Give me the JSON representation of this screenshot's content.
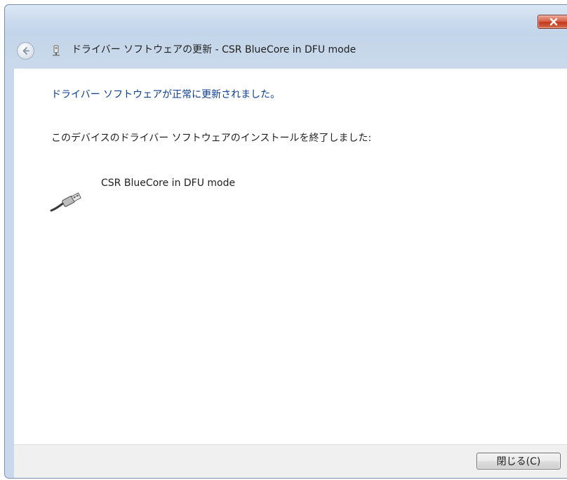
{
  "window": {
    "title": "ドライバー ソフトウェアの更新 - CSR BlueCore in DFU mode"
  },
  "content": {
    "success_message": "ドライバー ソフトウェアが正常に更新されました。",
    "finished_message": "このデバイスのドライバー ソフトウェアのインストールを終了しました:",
    "device_name": "CSR BlueCore in DFU mode",
    "device_icon": "usb-cable-icon"
  },
  "footer": {
    "close_label": "閉じる(C)"
  },
  "colors": {
    "link_blue": "#0b3d91",
    "frame": "#c3d5ea",
    "close_red": "#c4371c"
  }
}
